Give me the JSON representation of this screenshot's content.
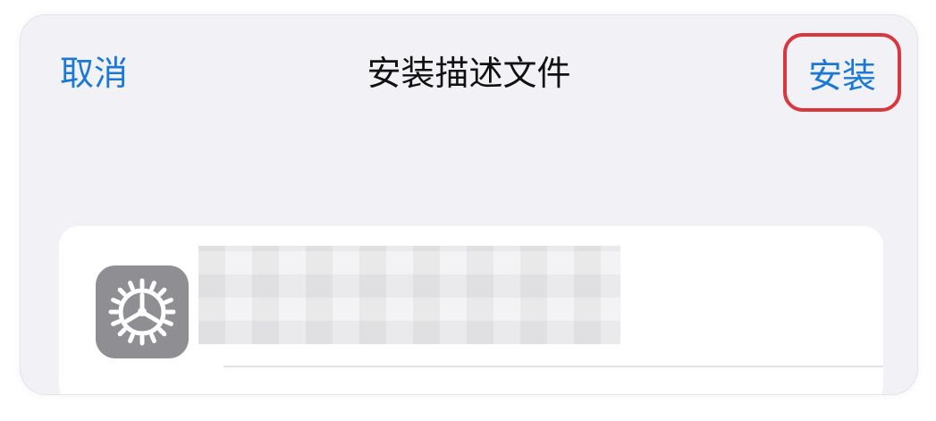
{
  "nav": {
    "cancel_label": "取消",
    "title": "安装描述文件",
    "install_label": "安装"
  },
  "profile": {
    "icon": "gear-icon",
    "name": ""
  },
  "colors": {
    "accent": "#1a78d6",
    "highlight": "#d9363e",
    "sheet_bg": "#f1f1f6",
    "icon_bg": "#8e8e93"
  }
}
